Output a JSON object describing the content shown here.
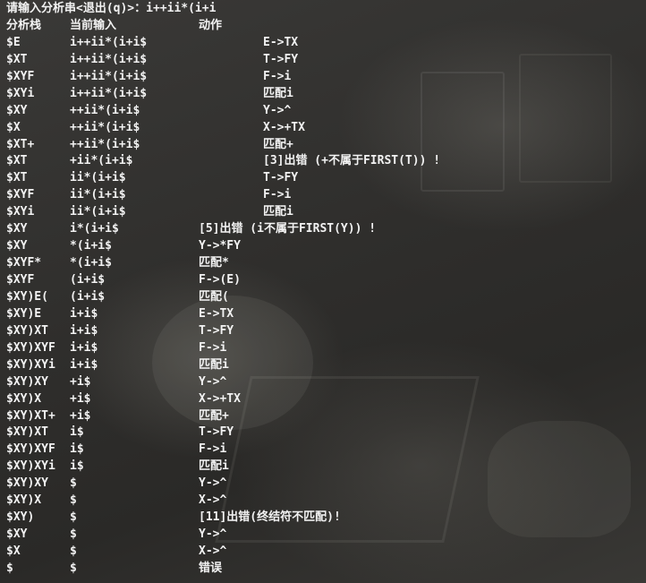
{
  "prompt": {
    "label": "请输入分析串<退出(q)>：",
    "value": "i++ii*(i+i"
  },
  "headers": {
    "stack": "分析栈",
    "input": "当前输入",
    "action": "动作"
  },
  "rows": [
    {
      "stack": "$E",
      "input": "i++ii*(i+i$",
      "action": "E->TX",
      "indent": 3
    },
    {
      "stack": "$XT",
      "input": "i++ii*(i+i$",
      "action": "T->FY",
      "indent": 3
    },
    {
      "stack": "$XYF",
      "input": "i++ii*(i+i$",
      "action": "F->i",
      "indent": 3
    },
    {
      "stack": "$XYi",
      "input": "i++ii*(i+i$",
      "action": "匹配i",
      "indent": 3
    },
    {
      "stack": "$XY",
      "input": "++ii*(i+i$",
      "action": "Y->^",
      "indent": 3
    },
    {
      "stack": "$X",
      "input": "++ii*(i+i$",
      "action": "X->+TX",
      "indent": 3
    },
    {
      "stack": "$XT+",
      "input": "++ii*(i+i$",
      "action": "匹配+",
      "indent": 3
    },
    {
      "stack": "$XT",
      "input": "+ii*(i+i$",
      "action": "[3]出错 (+不属于FIRST(T)) !",
      "indent": 3
    },
    {
      "stack": "$XT",
      "input": "ii*(i+i$",
      "action": "T->FY",
      "indent": 3
    },
    {
      "stack": "$XYF",
      "input": "ii*(i+i$",
      "action": "F->i",
      "indent": 3
    },
    {
      "stack": "$XYi",
      "input": "ii*(i+i$",
      "action": "匹配i",
      "indent": 3
    },
    {
      "stack": "$XY",
      "input": "i*(i+i$",
      "action": "[5]出错 (i不属于FIRST(Y)) !",
      "indent": 2
    },
    {
      "stack": "$XY",
      "input": "*(i+i$",
      "action": "Y->*FY",
      "indent": 2
    },
    {
      "stack": "$XYF*",
      "input": "*(i+i$",
      "action": "匹配*",
      "indent": 2
    },
    {
      "stack": "$XYF",
      "input": "(i+i$",
      "action": "F->(E)",
      "indent": 2
    },
    {
      "stack": "$XY)E(",
      "input": "(i+i$",
      "action": "匹配(",
      "indent": 2
    },
    {
      "stack": "$XY)E",
      "input": "i+i$",
      "action": "E->TX",
      "indent": 2
    },
    {
      "stack": "$XY)XT",
      "input": "i+i$",
      "action": "T->FY",
      "indent": 2
    },
    {
      "stack": "$XY)XYF",
      "input": "i+i$",
      "action": "F->i",
      "indent": 2
    },
    {
      "stack": "$XY)XYi",
      "input": "i+i$",
      "action": "匹配i",
      "indent": 2
    },
    {
      "stack": "$XY)XY",
      "input": "+i$",
      "action": "Y->^",
      "indent": 2
    },
    {
      "stack": "$XY)X",
      "input": "+i$",
      "action": "X->+TX",
      "indent": 2
    },
    {
      "stack": "$XY)XT+",
      "input": "+i$",
      "action": "匹配+",
      "indent": 2
    },
    {
      "stack": "$XY)XT",
      "input": "i$",
      "action": "T->FY",
      "indent": 2
    },
    {
      "stack": "$XY)XYF",
      "input": "i$",
      "action": "F->i",
      "indent": 2
    },
    {
      "stack": "$XY)XYi",
      "input": "i$",
      "action": "匹配i",
      "indent": 2
    },
    {
      "stack": "$XY)XY",
      "input": "$",
      "action": "Y->^",
      "indent": 2
    },
    {
      "stack": "$XY)X",
      "input": "$",
      "action": "X->^",
      "indent": 2
    },
    {
      "stack": "$XY)",
      "input": "$",
      "action": "[11]出错(终结符不匹配)!",
      "indent": 2
    },
    {
      "stack": "$XY",
      "input": "$",
      "action": "Y->^",
      "indent": 2
    },
    {
      "stack": "$X",
      "input": "$",
      "action": "X->^",
      "indent": 2
    },
    {
      "stack": "$",
      "input": "$",
      "action": "错误",
      "indent": 2
    }
  ],
  "colors": {
    "text": "#f2f2f2",
    "background": "#2b2a29"
  }
}
